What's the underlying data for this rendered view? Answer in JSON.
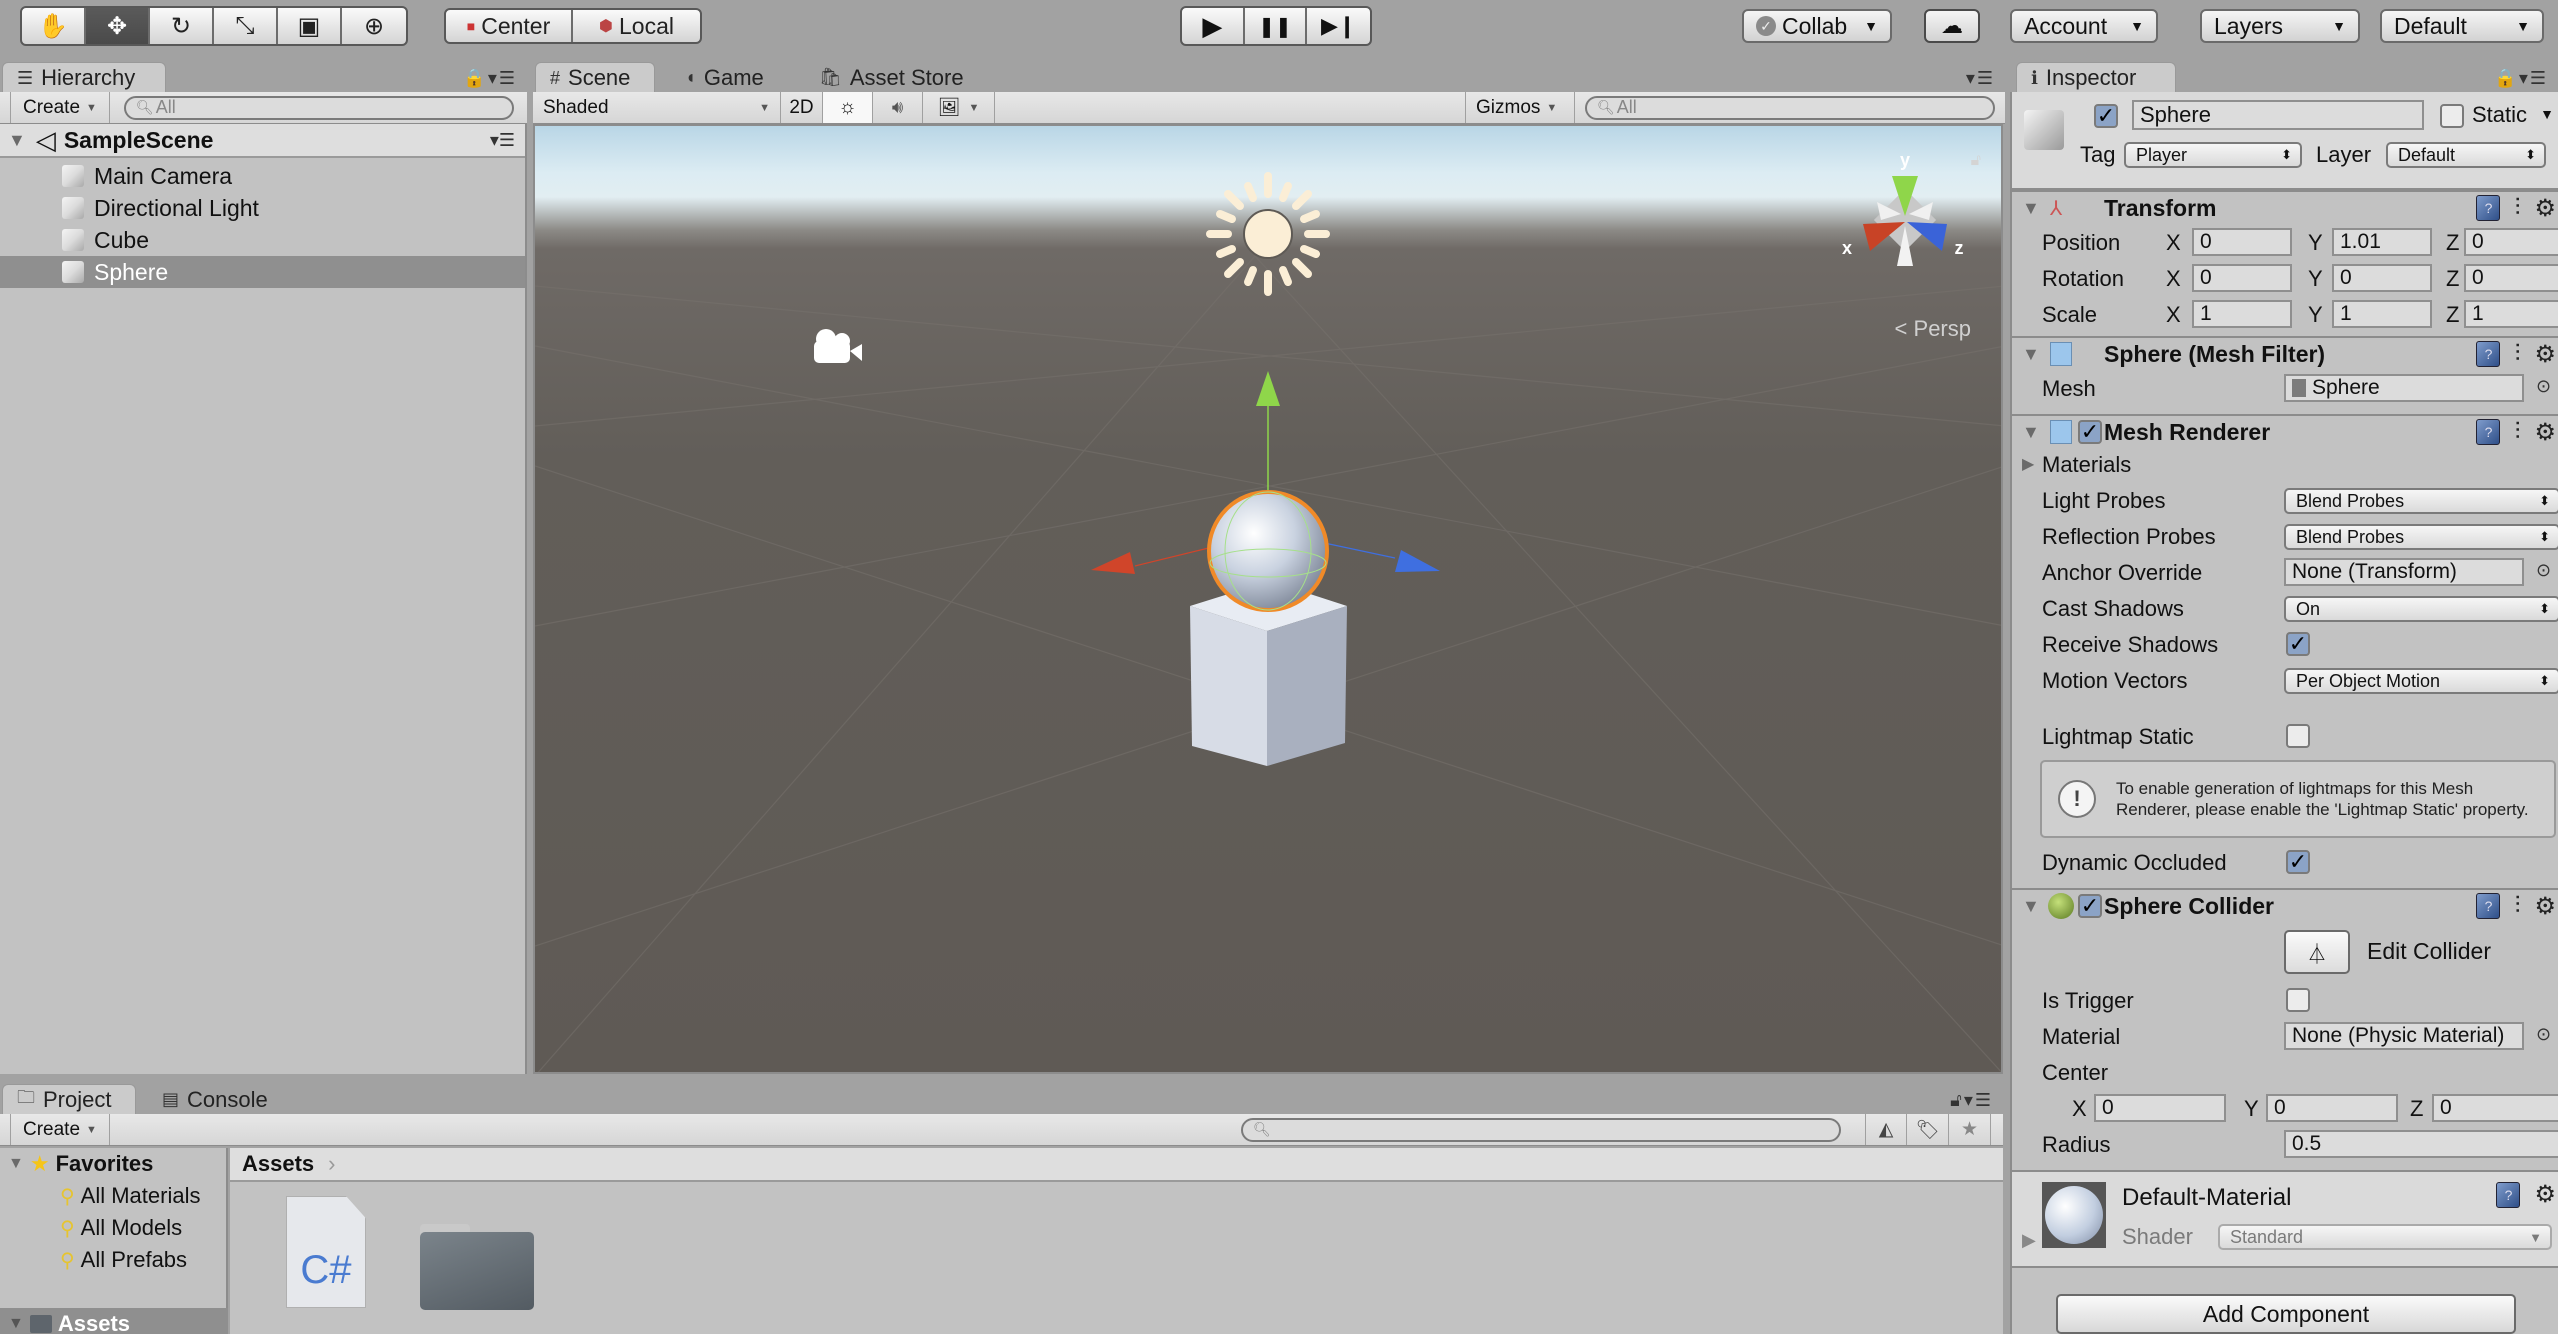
{
  "toolbar": {
    "tools": [
      {
        "name": "hand-tool",
        "glyph": "✋",
        "active": false
      },
      {
        "name": "move-tool",
        "glyph": "✥",
        "active": true
      },
      {
        "name": "rotate-tool",
        "glyph": "↻",
        "active": false
      },
      {
        "name": "scale-tool",
        "glyph": "⤡",
        "active": false
      },
      {
        "name": "rect-tool",
        "glyph": "▣",
        "active": false
      },
      {
        "name": "transform-tool",
        "glyph": "⊕",
        "active": false
      }
    ],
    "pivot_mode": "Center",
    "pivot_rotation": "Local",
    "play_glyph": "▶",
    "pause_glyph": "❚❚",
    "step_glyph": "▶❙",
    "collab": "Collab",
    "account": "Account",
    "layers": "Layers",
    "layout": "Default"
  },
  "hierarchy": {
    "tab_label": "Hierarchy",
    "create_label": "Create",
    "search_placeholder": "All",
    "scene_name": "SampleScene",
    "items": [
      {
        "label": "Main Camera",
        "selected": false
      },
      {
        "label": "Directional Light",
        "selected": false
      },
      {
        "label": "Cube",
        "selected": false
      },
      {
        "label": "Sphere",
        "selected": true
      }
    ]
  },
  "scene_panel": {
    "tabs": [
      {
        "label": "Scene",
        "active": true
      },
      {
        "label": "Game",
        "active": false
      },
      {
        "label": "Asset Store",
        "active": false
      }
    ],
    "draw_mode": "Shaded",
    "mode_2d": "2D",
    "gizmos_label": "Gizmos",
    "search_placeholder": "All",
    "projection_label": "Persp",
    "axis_labels": {
      "x": "x",
      "y": "y",
      "z": "z"
    }
  },
  "inspector": {
    "tab_label": "Inspector",
    "object": {
      "active": true,
      "name": "Sphere",
      "static_label": "Static",
      "static": false,
      "tag_label": "Tag",
      "tag": "Player",
      "layer_label": "Layer",
      "layer": "Default"
    },
    "transform": {
      "title": "Transform",
      "rows": [
        {
          "label": "Position",
          "x": "0",
          "y": "1.01",
          "z": "0"
        },
        {
          "label": "Rotation",
          "x": "0",
          "y": "0",
          "z": "0"
        },
        {
          "label": "Scale",
          "x": "1",
          "y": "1",
          "z": "1"
        }
      ]
    },
    "mesh_filter": {
      "title": "Sphere (Mesh Filter)",
      "mesh_label": "Mesh",
      "mesh": "Sphere"
    },
    "mesh_renderer": {
      "title": "Mesh Renderer",
      "enabled": true,
      "materials_label": "Materials",
      "light_probes_label": "Light Probes",
      "light_probes": "Blend Probes",
      "reflection_probes_label": "Reflection Probes",
      "reflection_probes": "Blend Probes",
      "anchor_override_label": "Anchor Override",
      "anchor_override": "None (Transform)",
      "cast_shadows_label": "Cast Shadows",
      "cast_shadows": "On",
      "receive_shadows_label": "Receive Shadows",
      "receive_shadows": true,
      "motion_vectors_label": "Motion Vectors",
      "motion_vectors": "Per Object Motion",
      "lightmap_static_label": "Lightmap Static",
      "lightmap_static": false,
      "info_message": "To enable generation of lightmaps for this Mesh Renderer, please enable the 'Lightmap Static' property.",
      "dynamic_occluded_label": "Dynamic Occluded",
      "dynamic_occluded": true
    },
    "sphere_collider": {
      "title": "Sphere Collider",
      "enabled": true,
      "edit_collider_label": "Edit Collider",
      "is_trigger_label": "Is Trigger",
      "is_trigger": false,
      "material_label": "Material",
      "material": "None (Physic Material)",
      "center_label": "Center",
      "center": {
        "x": "0",
        "y": "0",
        "z": "0"
      },
      "radius_label": "Radius",
      "radius": "0.5"
    },
    "material": {
      "name": "Default-Material",
      "shader_label": "Shader",
      "shader": "Standard"
    },
    "add_component_label": "Add Component"
  },
  "project": {
    "tabs": [
      {
        "label": "Project",
        "active": true
      },
      {
        "label": "Console",
        "active": false
      }
    ],
    "create_label": "Create",
    "favorites_label": "Favorites",
    "favorites": [
      "All Materials",
      "All Models",
      "All Prefabs"
    ],
    "assets_label": "Assets",
    "breadcrumb": "Assets",
    "asset_items": [
      {
        "type": "csharp-script",
        "glyph": "C#"
      },
      {
        "type": "folder"
      }
    ]
  },
  "colors": {
    "x_axis": "#d0452a",
    "y_axis": "#8fd64a",
    "z_axis": "#3f6fe0",
    "selection_outline": "#f08a28",
    "selected_row": "#8f8f8f",
    "checkbox_on": "#8ba3c6"
  }
}
